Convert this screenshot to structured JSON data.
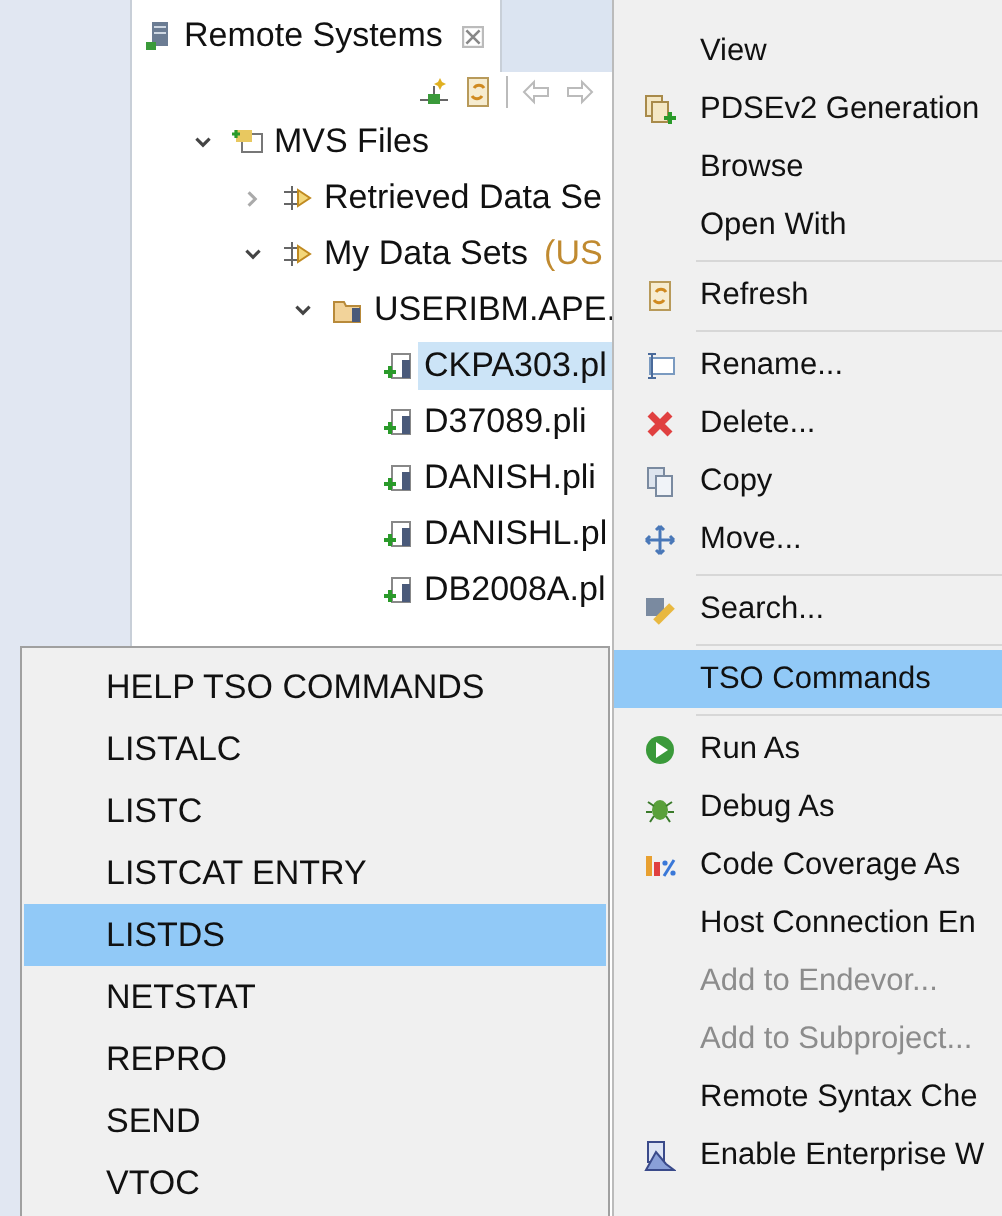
{
  "panel": {
    "tab": {
      "title": "Remote Systems",
      "selected": true
    }
  },
  "tree": [
    {
      "label": "MVS Files",
      "expanded": true,
      "children": [
        {
          "label": "Retrieved Data Se",
          "expanded": false
        },
        {
          "label": "My Data Sets",
          "suffix": "(US",
          "expanded": true,
          "children": [
            {
              "label": "USERIBM.APE.",
              "expanded": true,
              "children": [
                {
                  "label": "CKPA303.pl",
                  "selected": true
                },
                {
                  "label": "D37089.pli",
                  "selected": false
                },
                {
                  "label": "DANISH.pli",
                  "selected": false
                },
                {
                  "label": "DANISHL.pl",
                  "selected": false
                },
                {
                  "label": "DB2008A.pl",
                  "selected": false
                }
              ]
            }
          ]
        }
      ]
    }
  ],
  "context_menu": [
    {
      "kind": "item",
      "label": "View",
      "selected": false,
      "disabled": false
    },
    {
      "kind": "item",
      "label": "PDSEv2 Generation",
      "selected": false,
      "disabled": false
    },
    {
      "kind": "item",
      "label": "Browse",
      "selected": false,
      "disabled": false
    },
    {
      "kind": "item",
      "label": "Open With",
      "selected": false,
      "disabled": false
    },
    {
      "kind": "separator"
    },
    {
      "kind": "item",
      "label": "Refresh",
      "selected": false,
      "disabled": false
    },
    {
      "kind": "separator"
    },
    {
      "kind": "item",
      "label": "Rename...",
      "selected": false,
      "disabled": false
    },
    {
      "kind": "item",
      "label": "Delete...",
      "selected": false,
      "disabled": false
    },
    {
      "kind": "item",
      "label": "Copy",
      "selected": false,
      "disabled": false
    },
    {
      "kind": "item",
      "label": "Move...",
      "selected": false,
      "disabled": false
    },
    {
      "kind": "separator"
    },
    {
      "kind": "item",
      "label": "Search...",
      "selected": false,
      "disabled": false
    },
    {
      "kind": "separator"
    },
    {
      "kind": "item",
      "label": "TSO Commands",
      "selected": true,
      "disabled": false
    },
    {
      "kind": "separator"
    },
    {
      "kind": "item",
      "label": "Run As",
      "selected": false,
      "disabled": false
    },
    {
      "kind": "item",
      "label": "Debug As",
      "selected": false,
      "disabled": false
    },
    {
      "kind": "item",
      "label": "Code Coverage As",
      "selected": false,
      "disabled": false
    },
    {
      "kind": "item",
      "label": "Host Connection En",
      "selected": false,
      "disabled": false
    },
    {
      "kind": "item",
      "label": "Add to Endevor...",
      "selected": false,
      "disabled": true
    },
    {
      "kind": "item",
      "label": "Add to Subproject...",
      "selected": false,
      "disabled": true
    },
    {
      "kind": "item",
      "label": "Remote Syntax Che",
      "selected": false,
      "disabled": false
    },
    {
      "kind": "item",
      "label": "Enable Enterprise W",
      "selected": false,
      "disabled": false
    }
  ],
  "submenu": [
    {
      "label": "HELP TSO COMMANDS",
      "selected": false
    },
    {
      "label": "LISTALC",
      "selected": false
    },
    {
      "label": "LISTC",
      "selected": false
    },
    {
      "label": "LISTCAT ENTRY",
      "selected": false
    },
    {
      "label": "LISTDS",
      "selected": true
    },
    {
      "label": "NETSTAT",
      "selected": false
    },
    {
      "label": "REPRO",
      "selected": false
    },
    {
      "label": "SEND",
      "selected": false
    },
    {
      "label": "VTOC",
      "selected": false
    }
  ]
}
